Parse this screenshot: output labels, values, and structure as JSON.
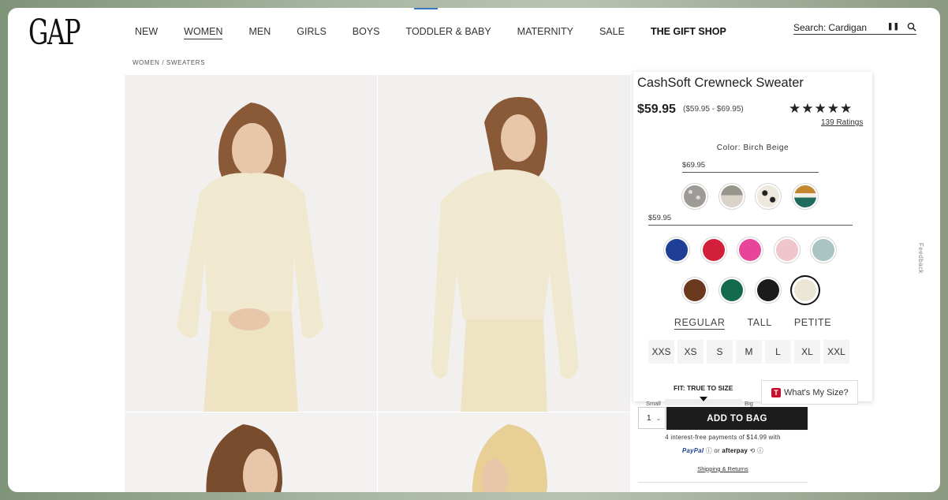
{
  "header": {
    "logo": "GAP",
    "nav": [
      {
        "label": "NEW",
        "active": false,
        "bold": false
      },
      {
        "label": "WOMEN",
        "active": true,
        "bold": false
      },
      {
        "label": "MEN",
        "active": false,
        "bold": false
      },
      {
        "label": "GIRLS",
        "active": false,
        "bold": false
      },
      {
        "label": "BOYS",
        "active": false,
        "bold": false
      },
      {
        "label": "TODDLER & BABY",
        "active": false,
        "bold": false
      },
      {
        "label": "MATERNITY",
        "active": false,
        "bold": false
      },
      {
        "label": "SALE",
        "active": false,
        "bold": false
      },
      {
        "label": "THE GIFT SHOP",
        "active": false,
        "bold": true
      }
    ],
    "search": {
      "label": "Search:",
      "value": "Cardigan",
      "mic_icon": "microphone-icon",
      "search_icon": "magnifier-icon"
    }
  },
  "breadcrumb": "WOMEN / SWEATERS",
  "product": {
    "title": "CashSoft Crewneck Sweater",
    "price": "$59.95",
    "price_range": "($59.95 - $69.95)",
    "stars": "★★★★★",
    "rating_value": 4.5,
    "ratings_link": "139 Ratings",
    "color_label": "Color: Birch Beige",
    "tiers": [
      {
        "price": "$69.95",
        "swatches": [
          "#9e9a96",
          "#b8b3ad",
          "#eee9df",
          "#1f6b5c"
        ]
      },
      {
        "price": "$59.95",
        "swatches": [
          "#1f3e96",
          "#d21f3b",
          "#e8459a",
          "#eec6cb",
          "#a9c4c2",
          "#6b3a1e",
          "#136a4f",
          "#1b1b1b",
          "#ece6d5"
        ]
      }
    ],
    "fits": [
      "REGULAR",
      "TALL",
      "PETITE"
    ],
    "sizes": [
      "XXS",
      "XS",
      "S",
      "M",
      "L",
      "XL",
      "XXL"
    ],
    "fit_label": "FIT: TRUE TO SIZE",
    "fit_small": "Small",
    "fit_big": "Big",
    "whats_my_size": "What's My Size?",
    "qty": "1",
    "add_to_bag": "ADD TO BAG",
    "payments_line": "4 interest-free payments of $14.99 with",
    "paypal": "PayPal",
    "or": "or",
    "afterpay": "afterpay",
    "shipping": "Shipping & Returns"
  },
  "feedback": "Feedback",
  "colors": {
    "accent": "#1c1c1c",
    "tt_red": "#c8102e",
    "paypal_blue": "#1a3f8f"
  }
}
